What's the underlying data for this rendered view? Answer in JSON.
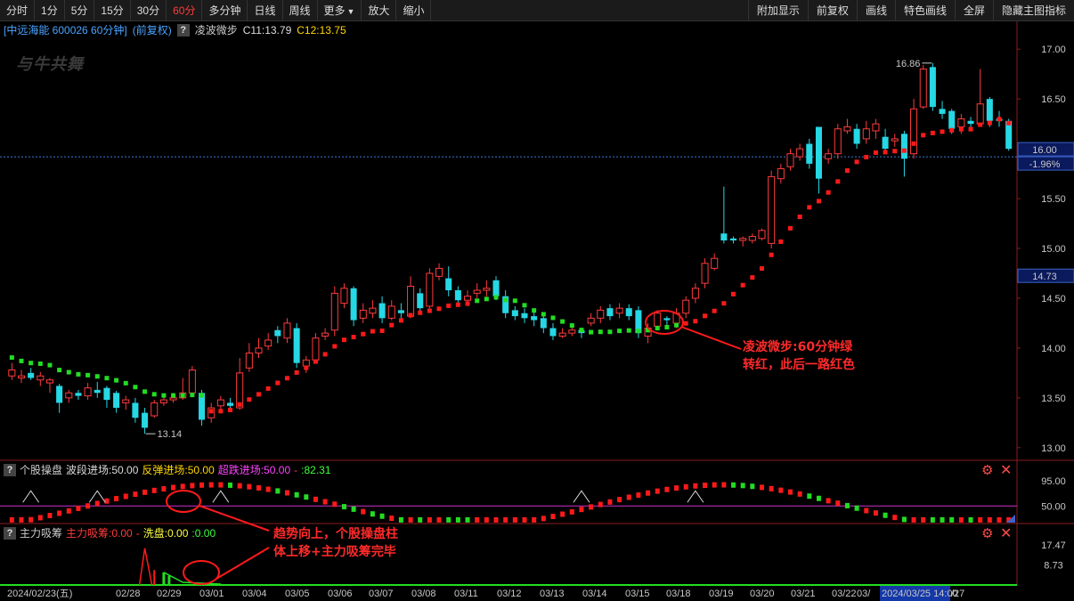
{
  "toolbar": {
    "left": [
      {
        "label": "分时",
        "active": false
      },
      {
        "label": "1分",
        "active": false
      },
      {
        "label": "5分",
        "active": false
      },
      {
        "label": "15分",
        "active": false
      },
      {
        "label": "30分",
        "active": false
      },
      {
        "label": "60分",
        "active": true
      },
      {
        "label": "多分钟",
        "active": false
      },
      {
        "label": "日线",
        "active": false
      },
      {
        "label": "周线",
        "active": false
      },
      {
        "label": "更多",
        "active": false,
        "dropdown": true
      },
      {
        "label": "放大",
        "active": false
      },
      {
        "label": "缩小",
        "active": false
      }
    ],
    "right": [
      "附加显示",
      "前复权",
      "画线",
      "特色画线",
      "全屏",
      "隐藏主图指标"
    ]
  },
  "header": {
    "stock_name": "[中远海能 600026 60分钟]",
    "adjust": "(前复权)",
    "help": "?",
    "indicator": "凌波微步",
    "c11": "C11:13.79",
    "c12": "C12:13.75"
  },
  "watermark": "与牛共舞",
  "main_axis": {
    "ticks": [
      "17.00",
      "16.50",
      "16.00",
      "15.50",
      "15.00",
      "14.50",
      "14.00",
      "13.50",
      "13.00"
    ],
    "ymin": 12.9,
    "ymax": 17.1,
    "current_price": "16.00",
    "current_change": "-1.96%",
    "marker_price": "14.73",
    "high_label": "16.86",
    "low_label": "13.14",
    "colors": {
      "up": "#ff3b3b",
      "down": "#26d7e4",
      "mark_bg": "#0b1a5c"
    }
  },
  "panel1": {
    "help": "?",
    "name": "个股操盘",
    "wave": "波段进场:50.00",
    "rebound": "反弹进场:50.00",
    "overfall": "超跌进场:50.00",
    "sep": "-",
    "value": ":82.31",
    "ticks": [
      "95.00",
      "50.00"
    ]
  },
  "panel2": {
    "help": "?",
    "name": "主力吸筹",
    "absorb": "主力吸筹:0.00",
    "sep": "-",
    "wash": "洗盘:0.00",
    "value": ":0.00",
    "ticks": [
      "17.47",
      "8.73"
    ]
  },
  "dates": [
    "2024/02/23(五)",
    "02/28",
    "02/29",
    "03/01",
    "03/04",
    "03/05",
    "03/06",
    "03/07",
    "03/08",
    "03/11",
    "03/12",
    "03/13",
    "03/14",
    "03/15",
    "03/18",
    "03/19",
    "03/20",
    "03/21",
    "03/22",
    "03/",
    "2024/03/25 14:00",
    "/27"
  ],
  "annotations": {
    "main_line1": "凌波微步:60分钟绿",
    "main_line2": "转红，此后一路红色",
    "sub_line1": "趋势向上，个股操盘柱",
    "sub_line2": "体上移+主力吸筹完毕"
  },
  "chart_data": {
    "type": "candlestick",
    "interval": "60min",
    "candles": [
      [
        13.72,
        13.78,
        13.85,
        13.68
      ],
      [
        13.7,
        13.72,
        13.78,
        13.65
      ],
      [
        13.75,
        13.7,
        13.8,
        13.68
      ],
      [
        13.68,
        13.72,
        13.76,
        13.62
      ],
      [
        13.65,
        13.68,
        13.7,
        13.55
      ],
      [
        13.62,
        13.45,
        13.64,
        13.35
      ],
      [
        13.5,
        13.55,
        13.58,
        13.45
      ],
      [
        13.55,
        13.52,
        13.58,
        13.48
      ],
      [
        13.52,
        13.6,
        13.65,
        13.48
      ],
      [
        13.58,
        13.55,
        13.66,
        13.5
      ],
      [
        13.6,
        13.48,
        13.62,
        13.4
      ],
      [
        13.55,
        13.4,
        13.57,
        13.35
      ],
      [
        13.45,
        13.48,
        13.52,
        13.38
      ],
      [
        13.45,
        13.3,
        13.5,
        13.25
      ],
      [
        13.35,
        13.2,
        13.4,
        13.14
      ],
      [
        13.32,
        13.45,
        13.48,
        13.3
      ],
      [
        13.45,
        13.48,
        13.52,
        13.42
      ],
      [
        13.48,
        13.5,
        13.55,
        13.45
      ],
      [
        13.5,
        13.55,
        13.7,
        13.48
      ],
      [
        13.55,
        13.78,
        13.82,
        13.52
      ],
      [
        13.55,
        13.28,
        13.58,
        13.22
      ],
      [
        13.3,
        13.4,
        13.45,
        13.25
      ],
      [
        13.42,
        13.48,
        13.52,
        13.38
      ],
      [
        13.45,
        13.42,
        13.5,
        13.38
      ],
      [
        13.4,
        13.75,
        13.9,
        13.38
      ],
      [
        13.8,
        13.95,
        14.05,
        13.76
      ],
      [
        13.95,
        14.0,
        14.1,
        13.9
      ],
      [
        14.02,
        14.08,
        14.15,
        13.98
      ],
      [
        14.18,
        14.12,
        14.22,
        14.05
      ],
      [
        14.1,
        14.25,
        14.3,
        14.05
      ],
      [
        14.2,
        13.85,
        14.25,
        13.8
      ],
      [
        13.82,
        13.88,
        13.92,
        13.75
      ],
      [
        13.88,
        14.1,
        14.15,
        13.85
      ],
      [
        14.12,
        14.15,
        14.2,
        14.08
      ],
      [
        14.18,
        14.55,
        14.62,
        14.12
      ],
      [
        14.45,
        14.6,
        14.65,
        14.4
      ],
      [
        14.6,
        14.28,
        14.62,
        14.22
      ],
      [
        14.3,
        14.38,
        14.45,
        14.25
      ],
      [
        14.35,
        14.4,
        14.48,
        14.3
      ],
      [
        14.45,
        14.3,
        14.52,
        14.25
      ],
      [
        14.3,
        14.42,
        14.48,
        14.28
      ],
      [
        14.38,
        14.35,
        14.45,
        14.3
      ],
      [
        14.32,
        14.62,
        14.72,
        14.3
      ],
      [
        14.55,
        14.4,
        14.6,
        14.35
      ],
      [
        14.42,
        14.75,
        14.8,
        14.4
      ],
      [
        14.72,
        14.8,
        14.85,
        14.68
      ],
      [
        14.7,
        14.58,
        14.82,
        14.52
      ],
      [
        14.58,
        14.48,
        14.62,
        14.45
      ],
      [
        14.48,
        14.52,
        14.58,
        14.42
      ],
      [
        14.55,
        14.58,
        14.65,
        14.5
      ],
      [
        14.58,
        14.6,
        14.68,
        14.52
      ],
      [
        14.68,
        14.52,
        14.72,
        14.48
      ],
      [
        14.52,
        14.35,
        14.58,
        14.3
      ],
      [
        14.38,
        14.32,
        14.42,
        14.28
      ],
      [
        14.35,
        14.3,
        14.4,
        14.25
      ],
      [
        14.32,
        14.28,
        14.38,
        14.22
      ],
      [
        14.3,
        14.2,
        14.35,
        14.15
      ],
      [
        14.2,
        14.12,
        14.25,
        14.08
      ],
      [
        14.12,
        14.15,
        14.2,
        14.1
      ],
      [
        14.15,
        14.18,
        14.22,
        14.12
      ],
      [
        14.18,
        14.15,
        14.2,
        14.1
      ],
      [
        14.25,
        14.3,
        14.35,
        14.22
      ],
      [
        14.3,
        14.38,
        14.42,
        14.25
      ],
      [
        14.4,
        14.32,
        14.44,
        14.28
      ],
      [
        14.35,
        14.4,
        14.45,
        14.3
      ],
      [
        14.4,
        14.32,
        14.44,
        14.28
      ],
      [
        14.38,
        14.15,
        14.42,
        14.1
      ],
      [
        14.12,
        14.2,
        14.25,
        14.05
      ],
      [
        14.22,
        14.35,
        14.38,
        14.18
      ],
      [
        14.3,
        14.28,
        14.32,
        14.22
      ],
      [
        14.25,
        14.35,
        14.4,
        14.2
      ],
      [
        14.35,
        14.48,
        14.52,
        14.3
      ],
      [
        14.5,
        14.6,
        14.65,
        14.45
      ],
      [
        14.65,
        14.85,
        14.9,
        14.6
      ],
      [
        14.8,
        14.9,
        14.95,
        14.78
      ],
      [
        15.15,
        15.08,
        15.62,
        15.05
      ],
      [
        15.1,
        15.08,
        15.12,
        15.05
      ],
      [
        15.08,
        15.1,
        15.12,
        15.02
      ],
      [
        15.08,
        15.12,
        15.15,
        15.05
      ],
      [
        15.1,
        15.18,
        15.2,
        15.08
      ],
      [
        15.05,
        15.72,
        15.78,
        15.0
      ],
      [
        15.7,
        15.8,
        15.85,
        15.65
      ],
      [
        15.82,
        15.95,
        16.0,
        15.78
      ],
      [
        15.92,
        16.0,
        16.05,
        15.88
      ],
      [
        16.05,
        15.85,
        16.1,
        15.8
      ],
      [
        16.22,
        15.7,
        16.22,
        15.55
      ],
      [
        15.9,
        15.95,
        16.0,
        15.85
      ],
      [
        15.95,
        16.2,
        16.25,
        15.9
      ],
      [
        16.18,
        16.22,
        16.3,
        16.15
      ],
      [
        16.2,
        16.05,
        16.25,
        16.0
      ],
      [
        16.1,
        16.2,
        16.28,
        16.05
      ],
      [
        16.18,
        16.25,
        16.3,
        16.1
      ],
      [
        16.12,
        16.0,
        16.2,
        15.95
      ],
      [
        16.08,
        16.1,
        16.15,
        16.02
      ],
      [
        16.15,
        15.9,
        16.18,
        15.72
      ],
      [
        15.95,
        16.4,
        16.5,
        15.9
      ],
      [
        16.42,
        16.8,
        16.84,
        16.4
      ],
      [
        16.82,
        16.42,
        16.86,
        16.38
      ],
      [
        16.4,
        16.35,
        16.48,
        16.3
      ],
      [
        16.38,
        16.2,
        16.4,
        16.15
      ],
      [
        16.22,
        16.3,
        16.35,
        16.15
      ],
      [
        16.28,
        16.25,
        16.32,
        16.2
      ],
      [
        16.25,
        16.45,
        16.8,
        16.22
      ],
      [
        16.5,
        16.28,
        16.52,
        16.22
      ],
      [
        16.3,
        16.28,
        16.38,
        16.22
      ],
      [
        16.28,
        16.0,
        16.3,
        15.98
      ]
    ],
    "lingbo_color_switch_index": 21,
    "panel1_baseline": 50.0,
    "panel1_max": 95.0
  }
}
